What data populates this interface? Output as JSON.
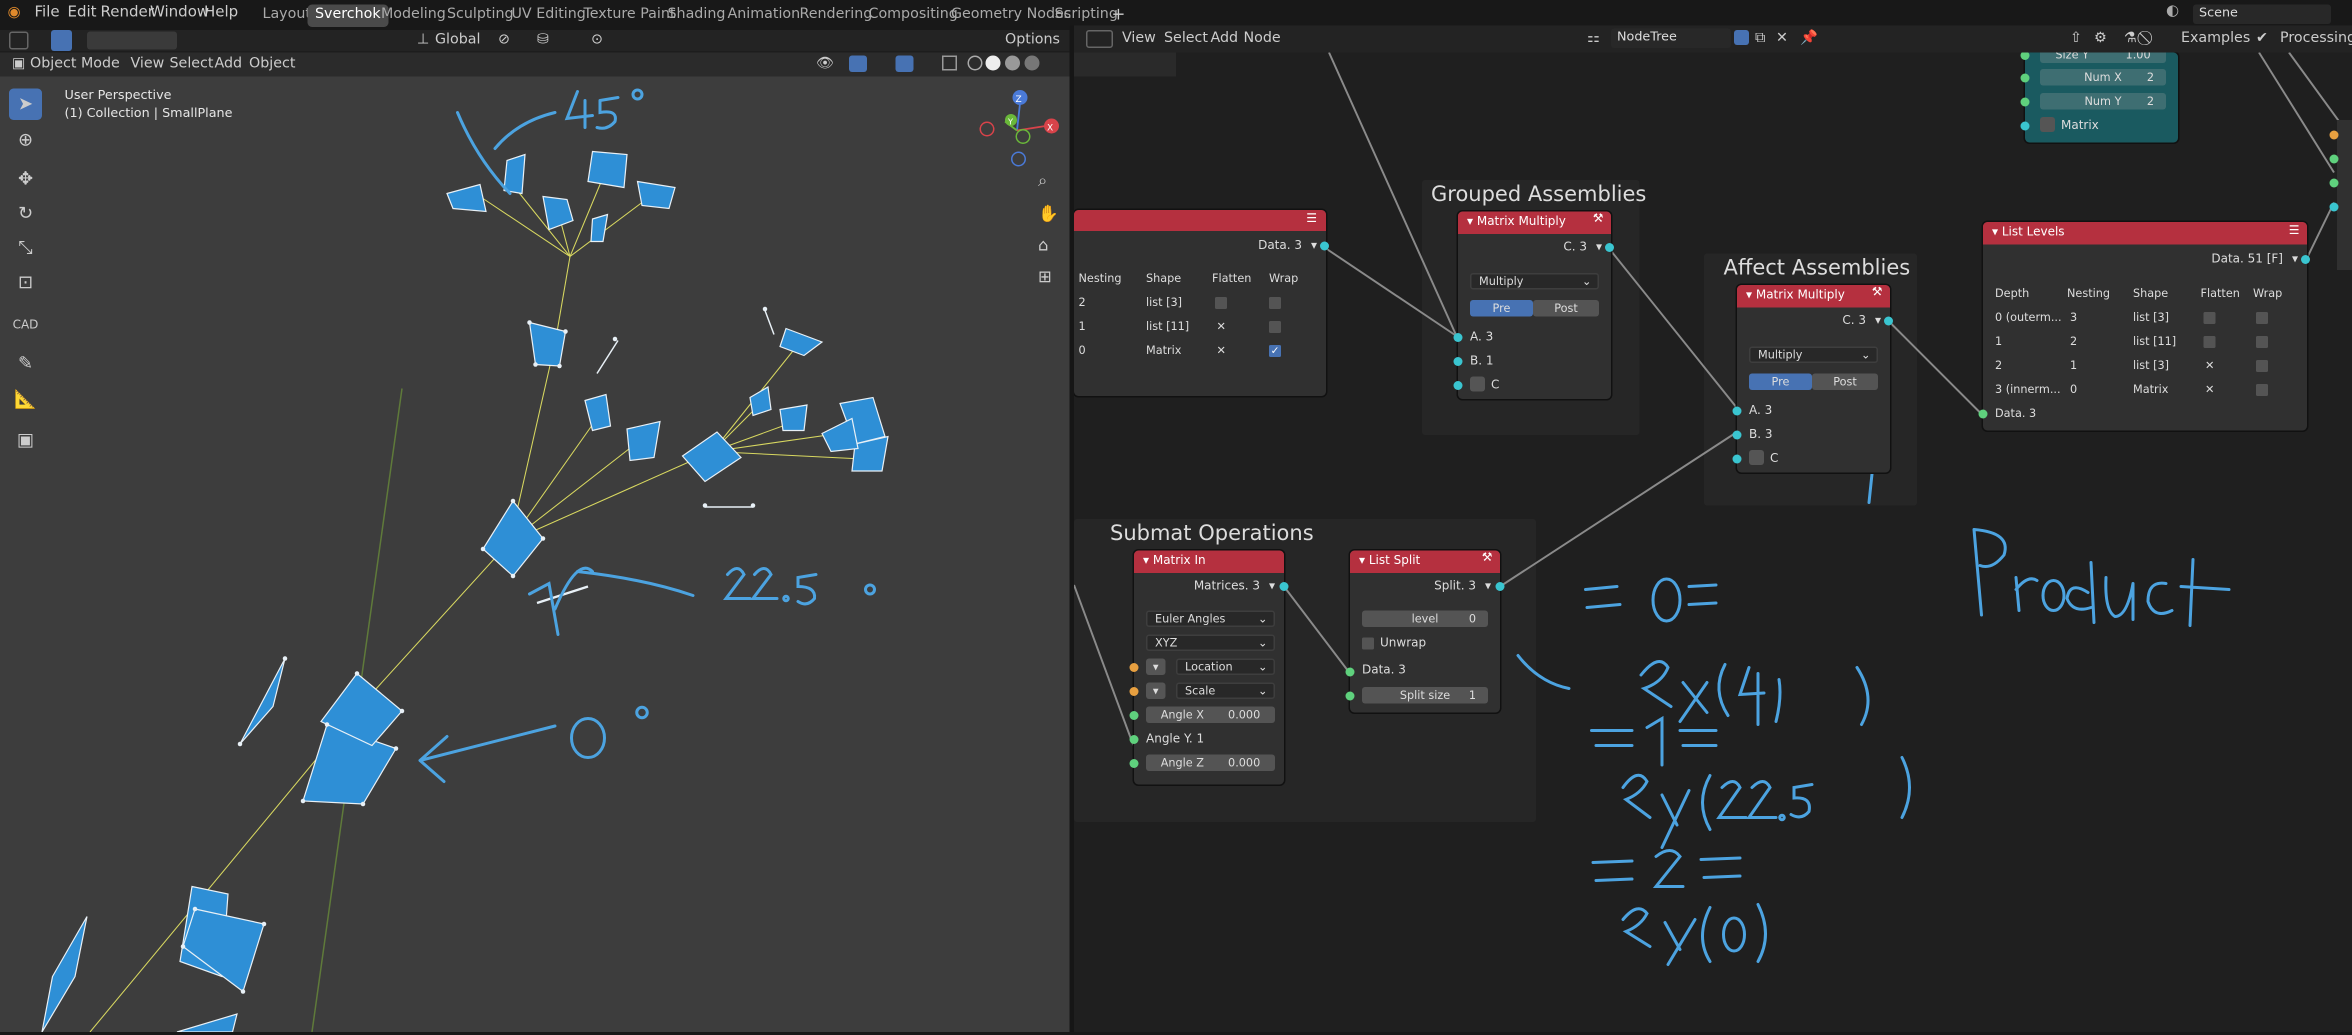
{
  "menubar": {
    "items": [
      "File",
      "Edit",
      "Render",
      "Window",
      "Help"
    ]
  },
  "workspaces": [
    "Layout",
    "Sverchok",
    "Modeling",
    "Sculpting",
    "UV Editing",
    "Texture Paint",
    "Shading",
    "Animation",
    "Rendering",
    "Compositing",
    "Geometry Nodes",
    "Scripting"
  ],
  "workspace_active": "Sverchok",
  "scene": "Scene",
  "viewport": {
    "mode": "Object Mode",
    "menus": [
      "View",
      "Select",
      "Add",
      "Object"
    ],
    "transform": "Global",
    "options": "Options",
    "perspective": "User Perspective",
    "collection": "(1) Collection | SmallPlane",
    "tool_label_cad": "CAD"
  },
  "node_editor": {
    "menus": [
      "View",
      "Select",
      "Add",
      "Node"
    ],
    "tree_name": "NodeTree",
    "examples": "Examples",
    "processing": "Processing"
  },
  "frames": {
    "grouped": "Grouped Assemblies",
    "affect": "Affect Assemblies",
    "submat": "Submat Operations"
  },
  "viewer_node": {
    "output": "Data. 3",
    "headers": [
      "Nesting",
      "Shape",
      "Flatten",
      "Wrap"
    ],
    "rows": [
      {
        "nesting": "2",
        "shape": "list [3]",
        "flatten": "",
        "wrap": ""
      },
      {
        "nesting": "1",
        "shape": "list [11]",
        "flatten": "✕",
        "wrap": ""
      },
      {
        "nesting": "0",
        "shape": "Matrix",
        "flatten": "✕",
        "wrap": "✓"
      }
    ]
  },
  "mm1": {
    "title": "Matrix Multiply",
    "out": "C. 3",
    "op": "Multiply",
    "pre": "Pre",
    "post": "Post",
    "a": "A. 3",
    "b": "B. 1",
    "c": "C"
  },
  "mm2": {
    "title": "Matrix Multiply",
    "out": "C. 3",
    "op": "Multiply",
    "pre": "Pre",
    "post": "Post",
    "a": "A. 3",
    "b": "B. 3",
    "c": "C"
  },
  "teal_node": {
    "size_y": "Size Y",
    "size_y_val": "1.00",
    "num_x": "Num X",
    "num_x_val": "2",
    "num_y": "Num Y",
    "num_y_val": "2",
    "matrix": "Matrix"
  },
  "list_levels": {
    "title": "List Levels",
    "output": "Data. 51 [F]",
    "headers": [
      "Depth",
      "Nesting",
      "Shape",
      "Flatten",
      "Wrap"
    ],
    "rows": [
      {
        "depth": "0 (outerm...",
        "nesting": "3",
        "shape": "list [3]",
        "flatten": "",
        "wrap": ""
      },
      {
        "depth": "1",
        "nesting": "2",
        "shape": "list [11]",
        "flatten": "",
        "wrap": ""
      },
      {
        "depth": "2",
        "nesting": "1",
        "shape": "list [3]",
        "flatten": "✕",
        "wrap": ""
      },
      {
        "depth": "3 (innerm...",
        "nesting": "0",
        "shape": "Matrix",
        "flatten": "✕",
        "wrap": ""
      }
    ],
    "input": "Data. 3"
  },
  "matrix_in": {
    "title": "Matrix In",
    "out": "Matrices. 3",
    "euler": "Euler Angles",
    "order": "XYZ",
    "location": "Location",
    "scale": "Scale",
    "angle_x": "Angle X",
    "angle_x_val": "0.000",
    "angle_y": "Angle Y. 1",
    "angle_z": "Angle Z",
    "angle_z_val": "0.000"
  },
  "list_split": {
    "title": "List Split",
    "out": "Split. 3",
    "level": "level",
    "level_val": "0",
    "unwrap": "Unwrap",
    "data": "Data. 3",
    "split_size": "Split size",
    "split_size_val": "1"
  },
  "colors": {
    "accent_blue": "#4772b3",
    "node_red": "#b5303f",
    "node_teal": "#17707a",
    "sock_green": "#5fd17d",
    "sock_cyan": "#3ac5d0",
    "plane_blue": "#2e8fd6",
    "ink": "#4ca3e0"
  }
}
